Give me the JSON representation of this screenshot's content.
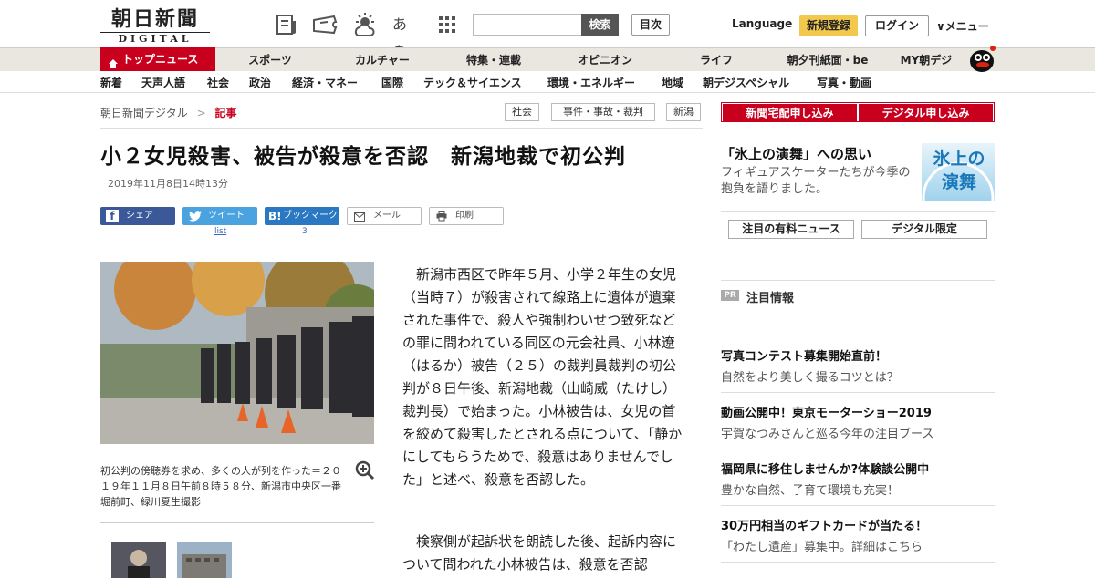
{
  "header": {
    "logo_main": "朝日新聞",
    "logo_sub": "DIGITAL",
    "search_button": "検索",
    "toc_button": "目次",
    "language": "Language",
    "register_button": "新規登録",
    "login_button": "ログイン",
    "menu": "∨メニュー",
    "icons": [
      "newspaper-icon",
      "ticket-icon",
      "weather-icon",
      "font-size-icon",
      "grid-icon"
    ],
    "font_size_glyph": "あぁ"
  },
  "nav_main": {
    "top": "トップニュース",
    "items": [
      "スポーツ",
      "カルチャー",
      "特集・連載",
      "オピニオン",
      "ライフ",
      "朝夕刊紙面・be",
      "MY朝デジ"
    ]
  },
  "nav_sub": {
    "items": [
      "新着",
      "天声人語",
      "社会",
      "政治",
      "経済・マネー",
      "国際",
      "テック＆サイエンス",
      "環境・エネルギー",
      "地域",
      "朝デジスペシャル",
      "写真・動画"
    ]
  },
  "breadcrumb": {
    "root": "朝日新聞デジタル",
    "sep": ">",
    "current": "記事"
  },
  "tags": [
    "社会",
    "事件・事故・裁判",
    "新潟"
  ],
  "article": {
    "title": "小２女児殺害、被告が殺意を否認　新潟地裁で初公判",
    "date": "2019年11月8日14時13分",
    "share": {
      "facebook": "シェア",
      "twitter": "ツイート",
      "twitter_sub": "list",
      "hatena": "ブックマーク",
      "hatena_count": "3",
      "mail": "メール",
      "print": "印刷"
    },
    "caption": "初公判の傍聴券を求め、多くの人が列を作った＝２０１９年１１月８日午前８時５８分、新潟市中央区一番堀前町、緑川夏生撮影",
    "body1": "新潟市西区で昨年５月、小学２年生の女児（当時７）が殺害されて線路上に遺体が遺棄された事件で、殺人や強制わいせつ致死などの罪に問われている同区の元会社員、小林遼（はるか）被告（２５）の裁判員裁判の初公判が８日午後、新潟地裁（山崎威（たけし）裁判長）で始まった。小林被告は、女児の首を絞めて殺害したとされる点について、「静かにしてもらうためで、殺意はありませんでした」と述べ、殺意を否認した。",
    "body2": "検察側が起訴状を朗読した後、起訴内容について問われた小林被告は、殺意を否認"
  },
  "sidebar": {
    "sub_buttons": [
      "新聞宅配申し込み",
      "デジタル申し込み"
    ],
    "promo": {
      "title": "「氷上の演舞」への思い",
      "text": "フィギュアスケーターたちが今季の抱負を語りました。",
      "image_text": "氷上の演舞"
    },
    "tabs": [
      "注目の有料ニュース",
      "デジタル限定"
    ],
    "pr_badge": "PR",
    "pr_label": "注目情報",
    "promos": [
      {
        "title": "写真コンテスト募集開始直前！",
        "text": "自然をより美しく撮るコツとは？"
      },
      {
        "title": "動画公開中！東京モーターショー2019",
        "text": "宇賀なつみさんと巡る今年の注目ブース"
      },
      {
        "title": "福岡県に移住しませんか?体験談公開中",
        "text": "豊かな自然、子育て環境も充実！"
      },
      {
        "title": "30万円相当のギフトカードが当たる！",
        "text": "「わたし遺産」募集中。詳細はこちら"
      }
    ]
  }
}
